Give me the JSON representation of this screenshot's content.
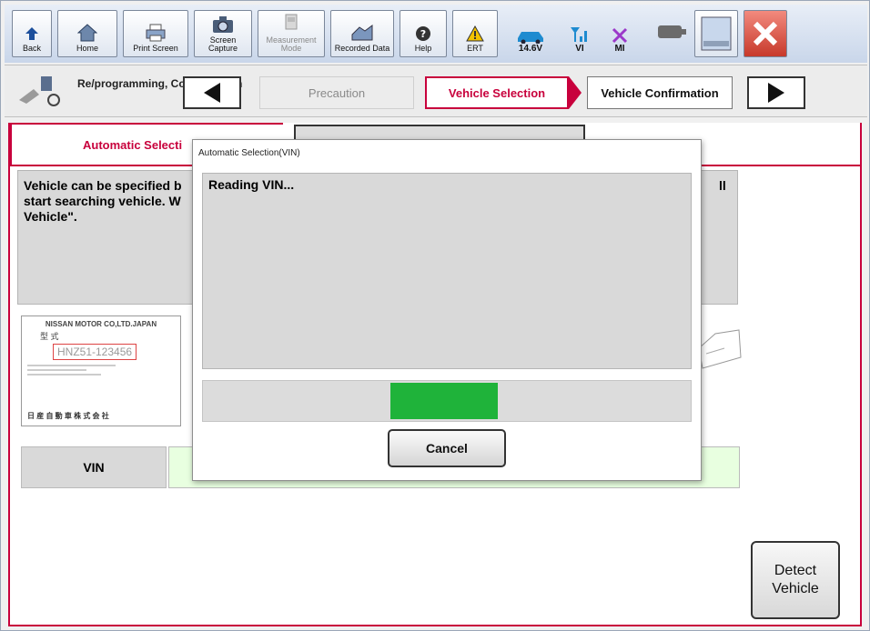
{
  "toolbar": {
    "back": "Back",
    "home": "Home",
    "print_screen": "Print Screen",
    "screen_capture": "Screen Capture",
    "measurement_mode": "Measurement Mode",
    "recorded_data": "Recorded Data",
    "help": "Help",
    "ert": "ERT",
    "battery_voltage": "14.6V",
    "vi": "VI",
    "mi": "MI"
  },
  "nav": {
    "mode_label": "Re/programming, Configuration",
    "steps": {
      "precaution": "Precaution",
      "vehicle_selection": "Vehicle Selection",
      "vehicle_confirmation": "Vehicle Confirmation"
    }
  },
  "tabs": {
    "automatic": "Automatic Selecti"
  },
  "main": {
    "instructions": [
      "Vehicle can be specified b",
      "start searching vehicle. W",
      "Vehicle\"."
    ],
    "right_fragment": "ll",
    "plate": {
      "maker": "NISSAN MOTOR CO,LTD.JAPAN",
      "type_kanji": "型 式",
      "vin_example": "HNZ51-123456",
      "footer": "日 産 自 動 車 株 式 会 社"
    },
    "vin_label": "VIN",
    "detect_button": "Detect Vehicle"
  },
  "dialog": {
    "title": "Automatic Selection(VIN)",
    "message": "Reading VIN...",
    "progress": 0.22,
    "cancel": "Cancel"
  },
  "colors": {
    "accent": "#c8003c",
    "progress": "#1fb33a",
    "vin_field": "#e8ffe0"
  }
}
